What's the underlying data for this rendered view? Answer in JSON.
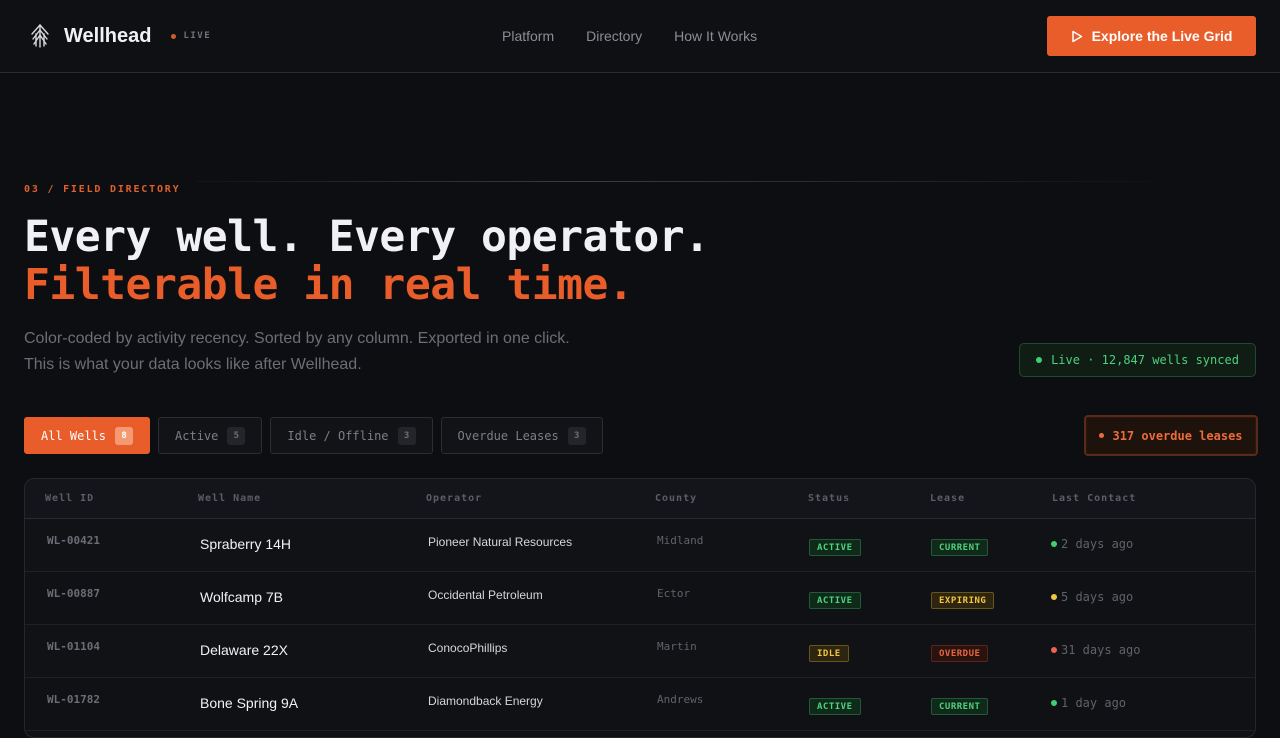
{
  "nav": {
    "brand": "Wellhead",
    "live_label": "LIVE",
    "links": [
      "Platform",
      "Directory",
      "How It Works"
    ],
    "cta": "Explore the Live Grid"
  },
  "hero": {
    "section_label": "03 / FIELD DIRECTORY",
    "title_line1": "Every well. Every operator.",
    "title_line2": "Filterable in real time.",
    "subtitle_line1": "Color-coded by activity recency. Sorted by any column. Exported in one click.",
    "subtitle_line2": "This is what your data looks like after Wellhead.",
    "sync_status": "Live · 12,847 wells synced"
  },
  "filters": [
    {
      "label": "All Wells",
      "count": "8"
    },
    {
      "label": "Active",
      "count": "5"
    },
    {
      "label": "Idle / Offline",
      "count": "3"
    },
    {
      "label": "Overdue Leases",
      "count": "3"
    }
  ],
  "overdue_alert": "317 overdue leases",
  "table": {
    "headers": [
      "Well ID",
      "Well Name",
      "Operator",
      "County",
      "Status",
      "Lease",
      "Last Contact"
    ],
    "rows": [
      {
        "id": "WL-00421",
        "name": "Spraberry 14H",
        "operator": "Pioneer Natural Resources",
        "county": "Midland",
        "status": "ACTIVE",
        "lease": "CURRENT",
        "last_contact": "2 days ago"
      },
      {
        "id": "WL-00887",
        "name": "Wolfcamp 7B",
        "operator": "Occidental Petroleum",
        "county": "Ector",
        "status": "ACTIVE",
        "lease": "EXPIRING",
        "last_contact": "5 days ago"
      },
      {
        "id": "WL-01104",
        "name": "Delaware 22X",
        "operator": "ConocoPhillips",
        "county": "Martin",
        "status": "IDLE",
        "lease": "OVERDUE",
        "last_contact": "31 days ago"
      },
      {
        "id": "WL-01782",
        "name": "Bone Spring 9A",
        "operator": "Diamondback Energy",
        "county": "Andrews",
        "status": "ACTIVE",
        "lease": "CURRENT",
        "last_contact": "1 day ago"
      }
    ]
  },
  "colors": {
    "accent": "#e85d2a",
    "status_green": "#4fd27e",
    "status_yellow": "#f1c441",
    "status_red": "#e8663f",
    "background": "#0d0e11"
  },
  "icons": {
    "brand": "wellhead-logo-icon",
    "cta": "play-icon"
  }
}
